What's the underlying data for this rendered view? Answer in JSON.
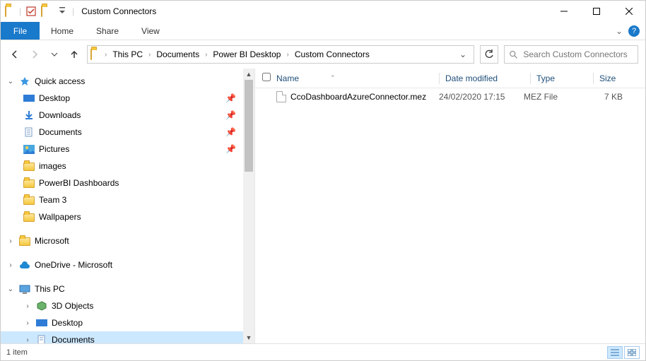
{
  "title": "Custom Connectors",
  "ribbon": {
    "file": "File",
    "tabs": [
      "Home",
      "Share",
      "View"
    ]
  },
  "breadcrumb": [
    "This PC",
    "Documents",
    "Power BI Desktop",
    "Custom Connectors"
  ],
  "search": {
    "placeholder": "Search Custom Connectors"
  },
  "tree": {
    "quick_access": "Quick access",
    "qa_items": [
      {
        "label": "Desktop",
        "pinned": true,
        "icon": "desktop"
      },
      {
        "label": "Downloads",
        "pinned": true,
        "icon": "downloads"
      },
      {
        "label": "Documents",
        "pinned": true,
        "icon": "documents"
      },
      {
        "label": "Pictures",
        "pinned": true,
        "icon": "pictures"
      },
      {
        "label": "images",
        "pinned": false,
        "icon": "folder"
      },
      {
        "label": "PowerBI Dashboards",
        "pinned": false,
        "icon": "folder"
      },
      {
        "label": "Team 3",
        "pinned": false,
        "icon": "folder"
      },
      {
        "label": "Wallpapers",
        "pinned": false,
        "icon": "folder"
      }
    ],
    "microsoft": "Microsoft",
    "onedrive": "OneDrive - Microsoft",
    "this_pc": "This PC",
    "pc_items": [
      {
        "label": "3D Objects"
      },
      {
        "label": "Desktop"
      },
      {
        "label": "Documents"
      }
    ]
  },
  "columns": {
    "name": "Name",
    "date": "Date modified",
    "type": "Type",
    "size": "Size"
  },
  "files": [
    {
      "name": "CcoDashboardAzureConnector.mez",
      "date": "24/02/2020 17:15",
      "type": "MEZ File",
      "size": "7 KB"
    }
  ],
  "status": "1 item"
}
